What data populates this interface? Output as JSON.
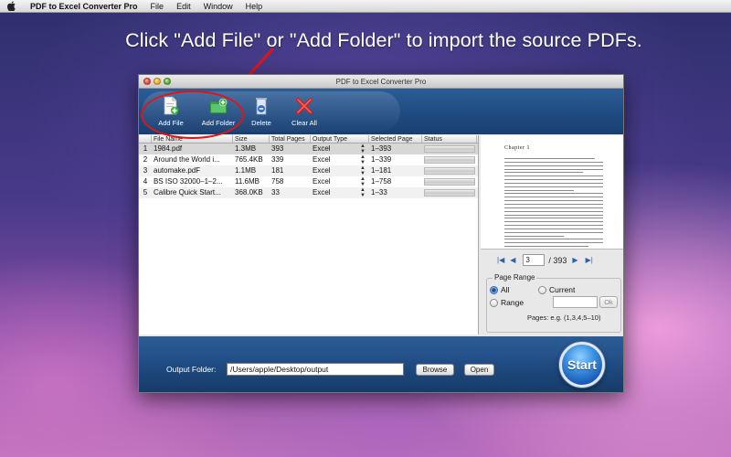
{
  "menubar": {
    "app_name": "PDF to Excel Converter Pro",
    "items": [
      "File",
      "Edit",
      "Window",
      "Help"
    ]
  },
  "headline": "Click \"Add File\" or \"Add Folder\" to import the source PDFs.",
  "window": {
    "title": "PDF to Excel Converter Pro"
  },
  "toolbar": {
    "add_file": "Add File",
    "add_folder": "Add Folder",
    "delete": "Delete",
    "clear_all": "Clear All"
  },
  "table": {
    "headers": [
      "",
      "File Name",
      "Size",
      "Total Pages",
      "Output Type",
      "Selected Page",
      "Status"
    ],
    "rows": [
      {
        "num": "1",
        "name": "1984.pdf",
        "size": "1.3MB",
        "pages": "393",
        "type": "Excel",
        "selected": "1–393"
      },
      {
        "num": "2",
        "name": "Around the World i...",
        "size": "765.4KB",
        "pages": "339",
        "type": "Excel",
        "selected": "1–339"
      },
      {
        "num": "3",
        "name": "automake.pdF",
        "size": "1.1MB",
        "pages": "181",
        "type": "Excel",
        "selected": "1–181"
      },
      {
        "num": "4",
        "name": "BS ISO 32000–1–2...",
        "size": "11.6MB",
        "pages": "758",
        "type": "Excel",
        "selected": "1–758"
      },
      {
        "num": "5",
        "name": "Calibre Quick Start...",
        "size": "368.0KB",
        "pages": "33",
        "type": "Excel",
        "selected": "1–33"
      }
    ]
  },
  "preview": {
    "chapter": "Chapter 1",
    "current_page": "3",
    "total_pages": "/ 393"
  },
  "page_range": {
    "title": "Page Range",
    "all": "All",
    "current": "Current",
    "range": "Range",
    "ok": "Ok",
    "hint": "Pages: e.g. (1,3,4,5–10)"
  },
  "output": {
    "label": "Output Folder:",
    "path": "/Users/apple/Desktop/output",
    "browse": "Browse",
    "open": "Open",
    "start": "Start"
  },
  "colors": {
    "toolbar_blue": "#1f4a80",
    "highlight_red": "#e21414"
  }
}
